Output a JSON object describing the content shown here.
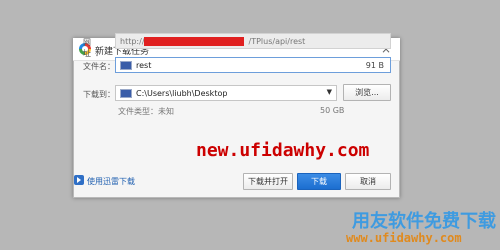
{
  "dialog": {
    "title": "新建下载任务",
    "close_glyph": "×"
  },
  "fields": {
    "url_label": "网  址：",
    "url_prefix": "http://",
    "url_suffix": "/TPlus/api/rest",
    "name_label": "文件名：",
    "name_value": "rest",
    "size": "91 B",
    "dir_label": "下载到：",
    "dir_value": "C:\\Users\\liubh\\Desktop",
    "browse_label": "浏览...",
    "filetype": "文件类型：未知",
    "freespace": "50 GB"
  },
  "footer": {
    "link_text": "使用迅雷下载",
    "open_label": "下载并打开",
    "download_label": "下载",
    "cancel_label": "取消"
  },
  "watermark": {
    "url": "new.ufidawhy.com",
    "cn": "用友软件免费下载",
    "domain": "www.ufidawhy.com"
  },
  "icons": [
    "app-logo-icon",
    "close-icon",
    "file-icon",
    "folder-icon",
    "dropdown-arrow-icon",
    "thunder-icon"
  ],
  "colors": {
    "primary_button": "#1c6ed0",
    "link": "#1f5fb0",
    "watermark_red": "#cc0000",
    "watermark_blue": "#3f9be0",
    "watermark_orange": "#e08a1e"
  }
}
